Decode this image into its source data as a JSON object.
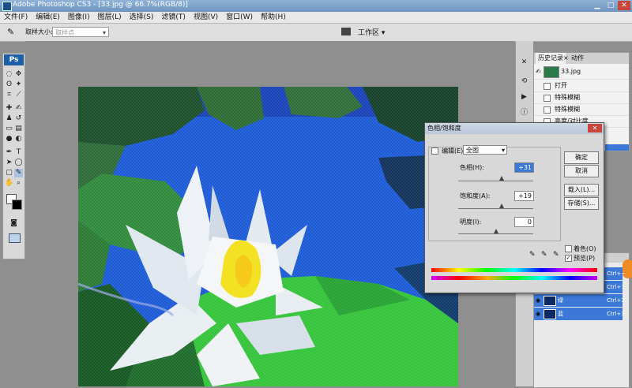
{
  "titlebar": {
    "title": "Adobe Photoshop CS3 - [33.jpg @ 66.7%(RGB/8)]"
  },
  "menubar": {
    "items": [
      "文件(F)",
      "编辑(E)",
      "图像(I)",
      "图层(L)",
      "选择(S)",
      "滤镜(T)",
      "视图(V)",
      "窗口(W)",
      "帮助(H)"
    ]
  },
  "optbar": {
    "sample_size_label": "取样大小:",
    "sample_size_value": "取样点",
    "workspace_label": "工作区 ▾"
  },
  "toolbox": {
    "logo": "Ps"
  },
  "history": {
    "tab_active": "历史记录",
    "tab_inactive": "动作",
    "snapshot": "33.jpg",
    "items": [
      "打开",
      "特殊模糊",
      "特殊模糊",
      "亮度/对比度"
    ]
  },
  "layers": {
    "rows": [
      {
        "name": "",
        "shortcut": "Ctrl+~"
      },
      {
        "name": "",
        "shortcut": "Ctrl+1"
      },
      {
        "name": "绿",
        "shortcut": "Ctrl+2"
      },
      {
        "name": "蓝",
        "shortcut": "Ctrl+3"
      }
    ]
  },
  "dialog": {
    "title": "色相/饱和度",
    "edit_label": "编辑(E):",
    "edit_value": "全图",
    "hue_label": "色相(H):",
    "hue_value": "+31",
    "saturation_label": "饱和度(A):",
    "saturation_value": "+19",
    "lightness_label": "明度(I):",
    "lightness_value": "0",
    "ok": "确定",
    "cancel": "取消",
    "load": "载入(L)...",
    "save": "存储(S)...",
    "colorize": "着色(O)",
    "preview": "预览(P)",
    "hue_pos": 0.58,
    "sat_pos": 0.58,
    "light_pos": 0.5
  }
}
